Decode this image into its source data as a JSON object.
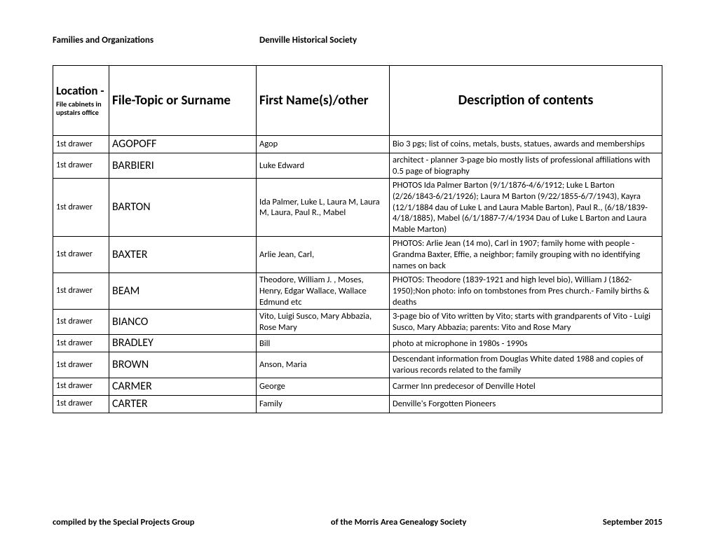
{
  "header": {
    "left": "Families and Organizations",
    "center": "Denville Historical Society"
  },
  "columns": {
    "loc_main": "Location -",
    "loc_sub": "File cabinets in upstairs office",
    "topic": "File-Topic or Surname",
    "first": "First Name(s)/other",
    "desc": "Description of contents"
  },
  "rows": [
    {
      "loc": "1st drawer",
      "topic": "AGOPOFF",
      "first": "Agop",
      "desc": "Bio 3 pgs; list of coins, metals, busts, statues, awards and memberships"
    },
    {
      "loc": "1st drawer",
      "topic": "BARBIERI",
      "first": "Luke Edward",
      "desc": "architect - planner 3-page bio mostly lists of professional affiliations with 0.5 page of biography"
    },
    {
      "loc": "1st drawer",
      "topic": "BARTON",
      "first": "Ida Palmer, Luke L, Laura M, Laura M, Laura, Paul R., Mabel",
      "desc": "PHOTOS  Ida Palmer Barton (9/1/1876-4/6/1912; Luke L Barton (2/26/1843-6/21/1926); Laura M Barton (9/22/1855-6/7/1943), Kayra (12/1/1884 dau of Luke L and Laura Mable Barton), Paul R., (6/18/1839-4/18/1885), Mabel (6/1/1887-7/4/1934 Dau of Luke L Barton and Laura Mable Marton)"
    },
    {
      "loc": "1st drawer",
      "topic": "BAXTER",
      "first": "Arlie Jean, Carl,",
      "desc": "PHOTOS: Arlie Jean (14 mo), Carl in 1907; family home with people -  Grandma Baxter, Effie, a neighbor; family grouping with no identifying names on back"
    },
    {
      "loc": "1st drawer",
      "topic": "BEAM",
      "first": "Theodore, William J. , Moses, Henry, Edgar Wallace, Wallace Edmund etc",
      "desc": "PHOTOS: Theodore (1839-1921 and high level bio), William J (1862-1950);Non photo: info on tombstones from Pres church.- Family births & deaths"
    },
    {
      "loc": "1st drawer",
      "topic": "BIANCO",
      "first": "Vito, Luigi Susco, Mary Abbazia, Rose Mary",
      "desc": "3-page bio of Vito written by Vito; starts with grandparents of Vito - Luigi Susco, Mary Abbazia; parents: Vito and Rose Mary"
    },
    {
      "loc": "1st drawer",
      "topic": "BRADLEY",
      "first": "Bill",
      "desc": "photo at microphone in 1980s - 1990s"
    },
    {
      "loc": "1st drawer",
      "topic": "BROWN",
      "first": "Anson, Maria",
      "desc": "Descendant information from Douglas White dated 1988 and copies of various records related to the family"
    },
    {
      "loc": "1st drawer",
      "topic": "CARMER",
      "first": "George",
      "desc": "Carmer Inn predecesor of Denville Hotel"
    },
    {
      "loc": "1st drawer",
      "topic": "CARTER",
      "first": "Family",
      "desc": "Denville's Forgotten Pioneers"
    }
  ],
  "footer": {
    "left": "compiled by the Special Projects Group",
    "center": "of the Morris Area Genealogy Society",
    "right": "September 2015"
  }
}
